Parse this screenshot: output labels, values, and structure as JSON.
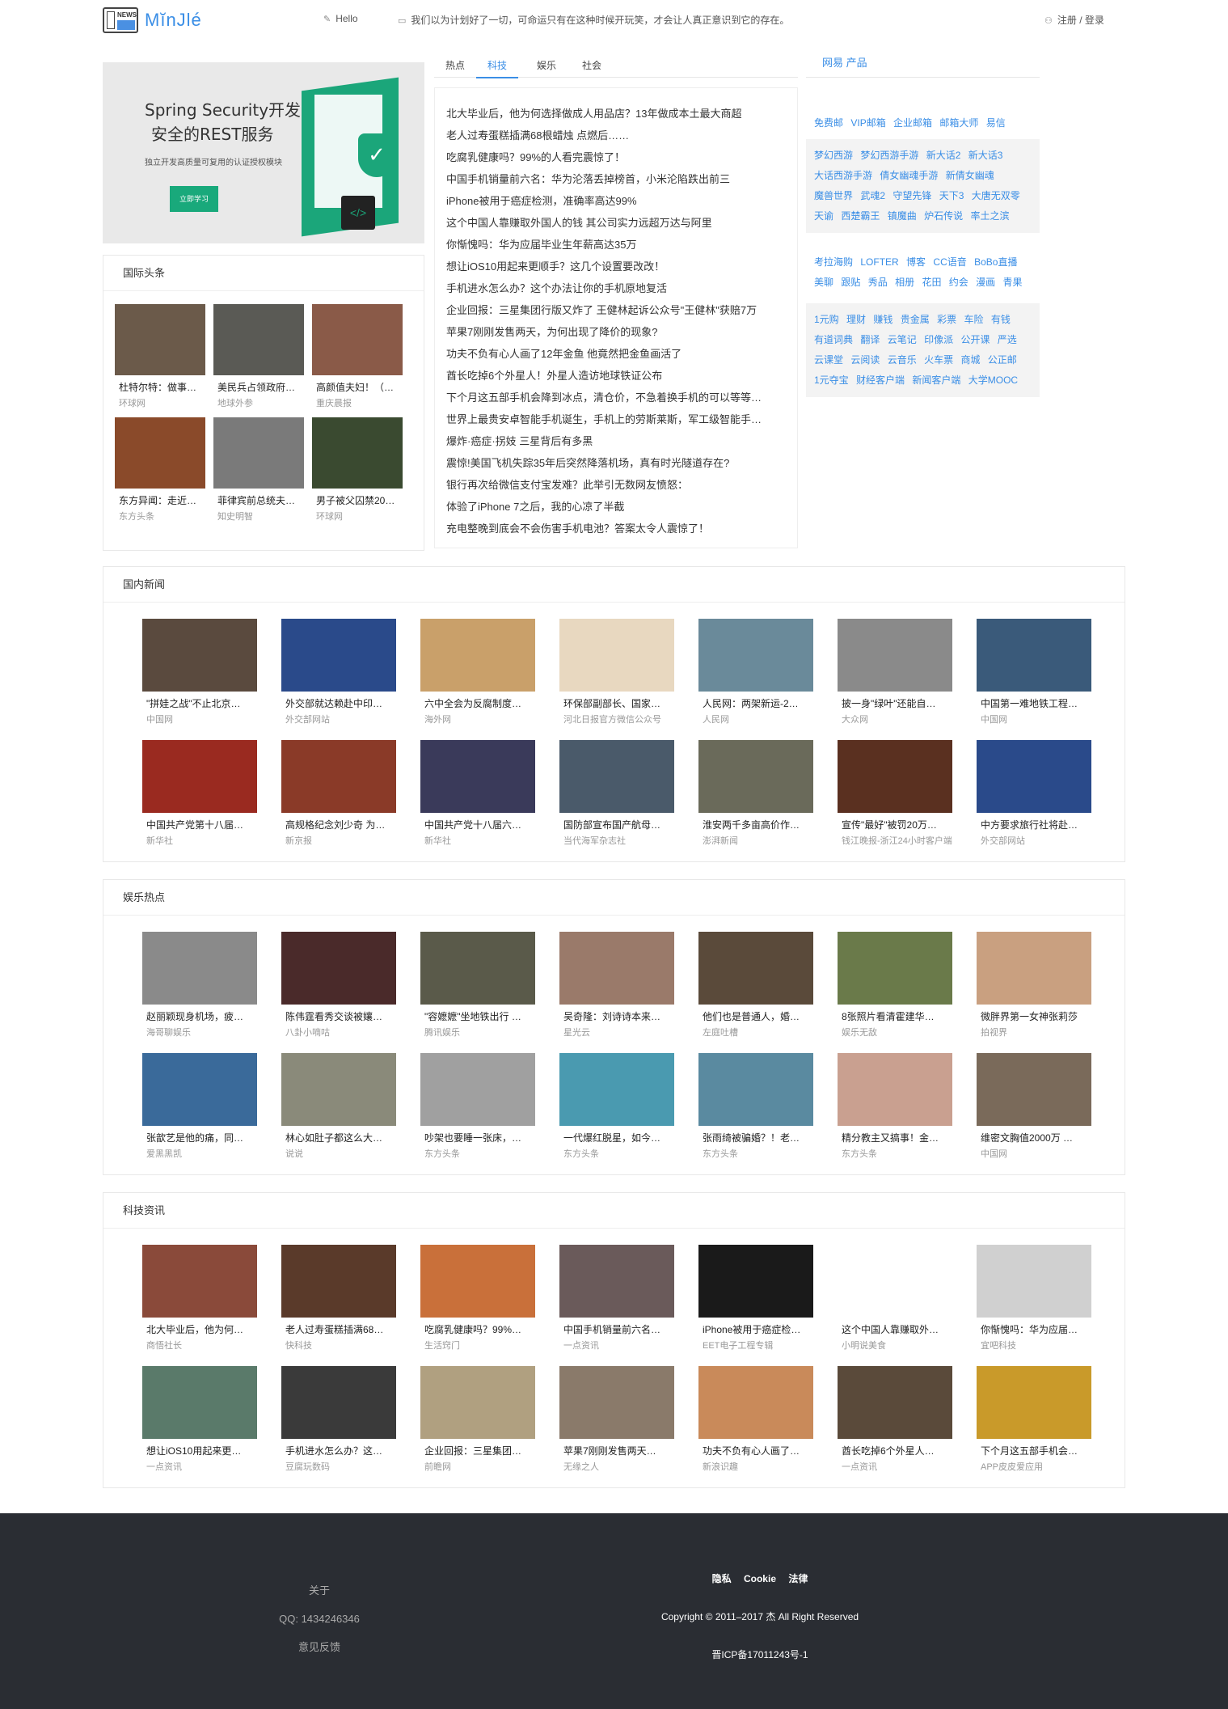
{
  "header": {
    "logo_badge": "NEWS",
    "logo_text": "MĭnJlé",
    "hello": "Hello",
    "quote": "我们以为计划好了一切，可命运只有在这种时候开玩笑，才会让人真正意识到它的存在。",
    "login": "注册 / 登录"
  },
  "banner": {
    "title_line1": "Spring Security开发",
    "title_line2": "安全的REST服务",
    "subtitle": "独立开发高质量可复用的认证授权模块",
    "button": "立即学习"
  },
  "intl": {
    "title": "国际头条",
    "items": [
      {
        "caption": "杜特尔特：做事…",
        "source": "环球网",
        "color": "#6b5a4a"
      },
      {
        "caption": "美民兵占领政府…",
        "source": "地球外参",
        "color": "#5a5a55"
      },
      {
        "caption": "高颜值夫妇！（…",
        "source": "重庆晨报",
        "color": "#8a5a48"
      },
      {
        "caption": "东方异闻：走近…",
        "source": "东方头条",
        "color": "#8a4a2a"
      },
      {
        "caption": "菲律宾前总统夫…",
        "source": "知史明智",
        "color": "#7a7a7a"
      },
      {
        "caption": "男子被父囚禁20…",
        "source": "环球网",
        "color": "#3a4a30"
      }
    ]
  },
  "tabs": [
    {
      "label": "热点",
      "active": false
    },
    {
      "label": "科技",
      "active": true
    },
    {
      "label": "娱乐",
      "active": false
    },
    {
      "label": "社会",
      "active": false
    }
  ],
  "headlines": [
    "北大毕业后，他为何选择做成人用品店？13年做成本土最大商超",
    "老人过寿蛋糕插满68根蜡烛 点燃后……",
    "吃腐乳健康吗？99%的人看完震惊了！",
    "中国手机销量前六名：华为沦落丢掉榜首，小米沦陷跌出前三",
    "iPhone被用于癌症检测，准确率高达99%",
    "这个中国人靠赚取外国人的钱 其公司实力远超万达与阿里",
    "你惭愧吗：华为应届毕业生年薪高达35万",
    "想让iOS10用起来更顺手？这几个设置要改改！",
    "手机进水怎么办？这个办法让你的手机原地复活",
    "企业回报：三星集团行版又炸了 王健林起诉公众号\"王健林\"获赔7万",
    "苹果7刚刚发售两天，为何出现了降价的现象?",
    "功夫不负有心人画了12年金鱼 他竟然把金鱼画活了",
    "酋长吃掉6个外星人！外星人造访地球铁证公布",
    "下个月这五部手机会降到冰点，清仓价，不急着换手机的可以等等…",
    "世界上最贵安卓智能手机诞生，手机上的劳斯莱斯，军工级智能手…",
    "爆炸·癌症·拐妓 三星背后有多黑",
    "震惊!美国飞机失踪35年后突然降落机场，真有时光隧道存在?",
    "银行再次给微信支付宝发难？此举引无数网友愤怒：",
    "体验了iPhone 7之后，我的心凉了半截",
    "充电整晚到底会不会伤害手机电池？答案太令人震惊了！"
  ],
  "sidebar": {
    "title": "网易 产品",
    "block1": [
      "免费邮",
      "VIP邮箱",
      "企业邮箱",
      "邮箱大师",
      "易信"
    ],
    "block2": [
      "梦幻西游",
      "梦幻西游手游",
      "新大话2",
      "新大话3",
      "大话西游手游",
      "倩女幽魂手游",
      "新倩女幽魂",
      "魔兽世界",
      "武魂2",
      "守望先锋",
      "天下3",
      "大唐无双零",
      "天谕",
      "西楚霸王",
      "镇魔曲",
      "炉石传说",
      "率土之滨"
    ],
    "block3": [
      "考拉海购",
      "LOFTER",
      "博客",
      "CC语音",
      "BoBo直播",
      "美聊",
      "跟贴",
      "秀品",
      "相册",
      "花田",
      "约会",
      "漫画",
      "青果"
    ],
    "block4": [
      "1元购",
      "理财",
      "赚钱",
      "贵金属",
      "彩票",
      "车险",
      "有钱",
      "有道词典",
      "翻译",
      "云笔记",
      "印像派",
      "公开课",
      "严选",
      "云课堂",
      "云阅读",
      "云音乐",
      "火车票",
      "商城",
      "公正邮",
      "1元夺宝",
      "财经客户端",
      "新闻客户端",
      "大学MOOC"
    ]
  },
  "domestic": {
    "title": "国内新闻",
    "items": [
      {
        "caption": "\"拼娃之战\"不止北京…",
        "source": "中国网",
        "color": "#5a4a3e"
      },
      {
        "caption": "外交部就达赖赴中印…",
        "source": "外交部网站",
        "color": "#2a4a8a"
      },
      {
        "caption": "六中全会为反腐制度…",
        "source": "海外网",
        "color": "#c9a06a"
      },
      {
        "caption": "环保部副部长、国家…",
        "source": "河北日报官方微信公众号",
        "color": "#e8d8c0"
      },
      {
        "caption": "人民网：两架新运-2…",
        "source": "人民网",
        "color": "#6a8a9a"
      },
      {
        "caption": "披一身\"绿叶\"还能自…",
        "source": "大众网",
        "color": "#8a8a8a"
      },
      {
        "caption": "中国第一难地铁工程…",
        "source": "中国网",
        "color": "#3a5a7a"
      },
      {
        "caption": "中国共产党第十八届…",
        "source": "新华社",
        "color": "#9a2a20"
      },
      {
        "caption": "高规格纪念刘少奇 为…",
        "source": "新京报",
        "color": "#8a3a28"
      },
      {
        "caption": "中国共产党十八届六…",
        "source": "新华社",
        "color": "#3a3a5a"
      },
      {
        "caption": "国防部宣布国产航母…",
        "source": "当代海军杂志社",
        "color": "#4a5a6a"
      },
      {
        "caption": "淮安两千多亩高价作…",
        "source": "澎湃新闻",
        "color": "#6a6a5a"
      },
      {
        "caption": "宣传\"最好\"被罚20万…",
        "source": "钱江晚报-浙江24小时客户端",
        "color": "#5a3020"
      },
      {
        "caption": "中方要求旅行社将赴…",
        "source": "外交部网站",
        "color": "#2a4a8a"
      }
    ]
  },
  "entertainment": {
    "title": "娱乐热点",
    "items": [
      {
        "caption": "赵丽颖现身机场，疲…",
        "source": "海哥聊娱乐",
        "color": "#8a8a8a"
      },
      {
        "caption": "陈伟霆看秀交谈被孃…",
        "source": "八卦小嘀咕",
        "color": "#4a2a2a"
      },
      {
        "caption": "\"容嬷嬷\"坐地铁出行 …",
        "source": "腾讯娱乐",
        "color": "#5a5a4a"
      },
      {
        "caption": "吴奇隆：刘诗诗本来…",
        "source": "星光云",
        "color": "#9a7a6a"
      },
      {
        "caption": "他们也是普通人，婚…",
        "source": "左庭吐槽",
        "color": "#5a4a3a"
      },
      {
        "caption": "8张照片看清霍建华…",
        "source": "娱乐无敌",
        "color": "#6a7a4a"
      },
      {
        "caption": "微胖界第一女神张莉莎",
        "source": "拍视界",
        "color": "#c9a080"
      },
      {
        "caption": "张歆艺是他的痛，同…",
        "source": "爱黑黑凯",
        "color": "#3a6a9a"
      },
      {
        "caption": "林心如肚子都这么大…",
        "source": "说说",
        "color": "#8a8a7a"
      },
      {
        "caption": "吵架也要睡一张床，…",
        "source": "东方头条",
        "color": "#a0a0a0"
      },
      {
        "caption": "一代爆红脱星，如今…",
        "source": "东方头条",
        "color": "#4a9ab0"
      },
      {
        "caption": "张雨绮被骗婚？！老…",
        "source": "东方头条",
        "color": "#5a8aa0"
      },
      {
        "caption": "精分教主又搞事！金…",
        "source": "东方头条",
        "color": "#c9a090"
      },
      {
        "caption": "维密文胸值2000万 …",
        "source": "中国网",
        "color": "#7a6a5a"
      }
    ]
  },
  "tech": {
    "title": "科技资讯",
    "items": [
      {
        "caption": "北大毕业后，他为何…",
        "source": "商悟社长",
        "color": "#8a4a3a"
      },
      {
        "caption": "老人过寿蛋糕插满68…",
        "source": "快科技",
        "color": "#5a3a2a"
      },
      {
        "caption": "吃腐乳健康吗？99%…",
        "source": "生活窍门",
        "color": "#c9703a"
      },
      {
        "caption": "中国手机销量前六名…",
        "source": "一点资讯",
        "color": "#6a5a5a"
      },
      {
        "caption": "iPhone被用于癌症检…",
        "source": "EET电子工程专辑",
        "color": "#1a1a1a"
      },
      {
        "caption": "这个中国人靠赚取外…",
        "source": "小明说美食",
        "color": "#ffffff"
      },
      {
        "caption": "你惭愧吗：华为应届…",
        "source": "宜吧科技",
        "color": "#d0d0d0"
      },
      {
        "caption": "想让iOS10用起来更…",
        "source": "一点资讯",
        "color": "#5a7a6a"
      },
      {
        "caption": "手机进水怎么办？这…",
        "source": "豆腐玩数码",
        "color": "#3a3a3a"
      },
      {
        "caption": "企业回报：三星集团…",
        "source": "前瞻网",
        "color": "#b0a080"
      },
      {
        "caption": "苹果7刚刚发售两天…",
        "source": "无缘之人",
        "color": "#8a7a6a"
      },
      {
        "caption": "功夫不负有心人画了…",
        "source": "新浪识趣",
        "color": "#c98a5a"
      },
      {
        "caption": "酋长吃掉6个外星人…",
        "source": "一点资讯",
        "color": "#5a4a3a"
      },
      {
        "caption": "下个月这五部手机会…",
        "source": "APP皮皮爱应用",
        "color": "#c99a2a"
      }
    ]
  },
  "footer": {
    "about": "关于",
    "qq": "QQ:  1434246346",
    "feedback": "意见反馈",
    "links": [
      "隐私",
      "Cookie",
      "法律"
    ],
    "copyright": "Copyright © 2011–2017 杰 All Right Reserved",
    "icp": "晋ICP备17011243号-1"
  }
}
